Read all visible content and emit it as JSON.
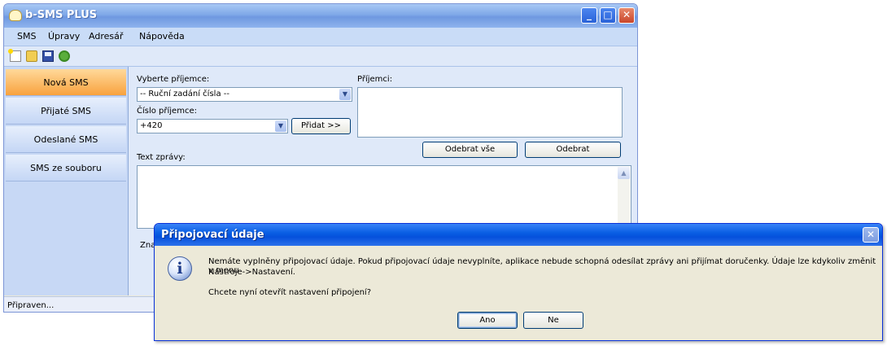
{
  "window": {
    "title": "b-SMS PLUS"
  },
  "menu": [
    "SMS",
    "Úpravy",
    "Adresář",
    "Nápověda"
  ],
  "sidebar": {
    "items": [
      "Nová SMS",
      "Přijaté SMS",
      "Odeslané SMS",
      "SMS ze souboru"
    ],
    "active_index": 0
  },
  "form": {
    "recipient_select_label": "Vyberte příjemce:",
    "recipient_select_value": "-- Ruční zadání čísla --",
    "recipient_number_label": "Číslo příjemce:",
    "recipient_number_value": "+420",
    "add_button": "Přidat >>",
    "recipients_label": "Příjemci:",
    "remove_all_button": "Odebrat vše",
    "remove_button": "Odebrat",
    "message_label": "Text zprávy:",
    "chars_label_partial": "Znak"
  },
  "status": {
    "text": "Připraven..."
  },
  "dialog": {
    "title": "Připojovací údaje",
    "message_line1": "Nemáte vyplněny připojovací údaje. Pokud připojovací údaje nevyplníte, aplikace nebude schopná odesílat zprávy ani přijímat doručenky. Údaje lze kdykoliv změnit v menu",
    "message_line2": "Nástroje->Nastavení.",
    "question": "Chcete nyní otevřít nastavení připojení?",
    "yes_button": "Ano",
    "no_button": "Ne",
    "close_glyph": "✕"
  },
  "icons": {
    "info": "i",
    "combo_arrow": "▼",
    "scroll_up": "▲"
  }
}
